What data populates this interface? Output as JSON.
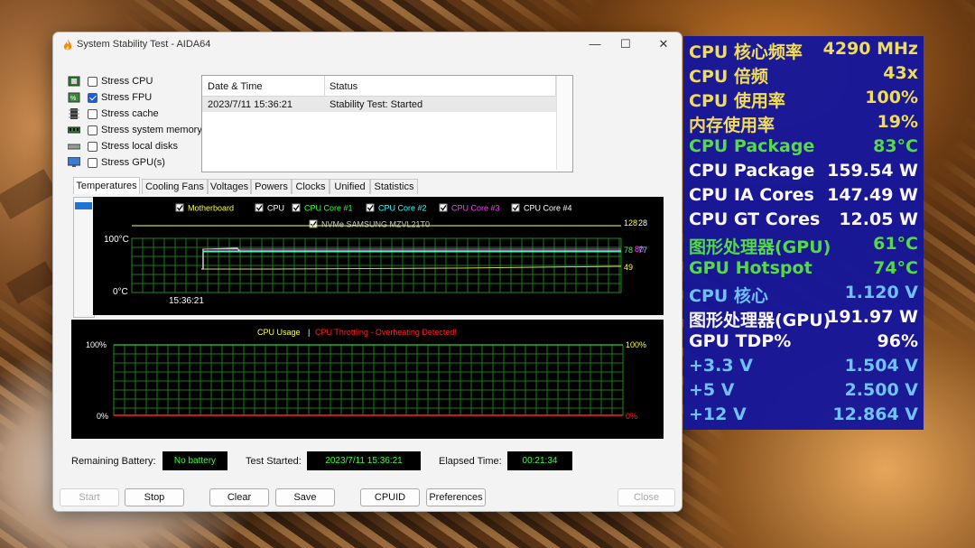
{
  "window": {
    "title": "System Stability Test - AIDA64",
    "minimize": "—",
    "maximize": "☐",
    "close": "✕"
  },
  "stress_options": [
    {
      "label": "Stress CPU",
      "checked": false,
      "icon": "cpu-chip-icon"
    },
    {
      "label": "Stress FPU",
      "checked": true,
      "icon": "fpu-chip-icon"
    },
    {
      "label": "Stress cache",
      "checked": false,
      "icon": "cache-chip-icon"
    },
    {
      "label": "Stress system memory",
      "checked": false,
      "icon": "memory-module-icon"
    },
    {
      "label": "Stress local disks",
      "checked": false,
      "icon": "disk-drive-icon"
    },
    {
      "label": "Stress GPU(s)",
      "checked": false,
      "icon": "monitor-icon"
    }
  ],
  "log": {
    "headers": [
      "Date & Time",
      "Status"
    ],
    "rows": [
      {
        "datetime": "2023/7/11 15:36:21",
        "status": "Stability Test: Started"
      }
    ]
  },
  "tabs": [
    "Temperatures",
    "Cooling Fans",
    "Voltages",
    "Powers",
    "Clocks",
    "Unified",
    "Statistics"
  ],
  "active_tab": "Temperatures",
  "temp_graph": {
    "legend": [
      {
        "label": "Motherboard",
        "color": "#ffff40"
      },
      {
        "label": "CPU",
        "color": "#ffffff"
      },
      {
        "label": "CPU Core #1",
        "color": "#40ff40"
      },
      {
        "label": "CPU Core #2",
        "color": "#40ffff"
      },
      {
        "label": "CPU Core #3",
        "color": "#ff40ff"
      },
      {
        "label": "CPU Core #4",
        "color": "#ffffff"
      }
    ],
    "legend2": {
      "label": "NVMe SAMSUNG MZVL21T0",
      "color": "#c8c8c8"
    },
    "y_top": "100°C",
    "y_bottom": "0°C",
    "x_label": "15:36:21",
    "right_values": [
      {
        "text": "128",
        "color": "#ffff40"
      },
      {
        "text": "28",
        "color": "#ffffff"
      },
      {
        "text": "78",
        "color": "#40ff40"
      },
      {
        "text": "80",
        "color": "#ff40ff"
      },
      {
        "text": "77",
        "color": "#40ffff"
      },
      {
        "text": "49",
        "color": "#ffff40"
      }
    ]
  },
  "usage_graph": {
    "title_left": "CPU Usage",
    "title_sep": "|",
    "title_right": "CPU Throttling - Overheating Detected!",
    "y_top_left": "100%",
    "y_bottom_left": "0%",
    "y_top_right": "100%",
    "y_bottom_right": "0%"
  },
  "status": {
    "battery_label": "Remaining Battery:",
    "battery_value": "No battery",
    "started_label": "Test Started:",
    "started_value": "2023/7/11 15:36:21",
    "elapsed_label": "Elapsed Time:",
    "elapsed_value": "00:21:34"
  },
  "buttons": {
    "start": "Start",
    "stop": "Stop",
    "clear": "Clear",
    "save": "Save",
    "cpuid": "CPUID",
    "preferences": "Preferences",
    "close": "Close"
  },
  "osd": [
    {
      "label": "CPU 核心频率",
      "value": "4290 MHz",
      "color": "#f3e25a"
    },
    {
      "label": "CPU 倍频",
      "value": "43x",
      "color": "#f3e25a"
    },
    {
      "label": "CPU 使用率",
      "value": "100%",
      "color": "#f3e25a"
    },
    {
      "label": "内存使用率",
      "value": "19%",
      "color": "#f3e25a"
    },
    {
      "label": "CPU Package",
      "value": "83°C",
      "color": "#54e04a"
    },
    {
      "label": "CPU Package",
      "value": "159.54 W",
      "color": "#ffffff"
    },
    {
      "label": "CPU IA Cores",
      "value": "147.49 W",
      "color": "#ffffff"
    },
    {
      "label": "CPU GT Cores",
      "value": "12.05 W",
      "color": "#ffffff"
    },
    {
      "label": "图形处理器(GPU)",
      "value": "61°C",
      "color": "#54e04a"
    },
    {
      "label": "GPU Hotspot",
      "value": "74°C",
      "color": "#54e04a"
    },
    {
      "label": "CPU 核心",
      "value": "1.120 V",
      "color": "#6ec6ff"
    },
    {
      "label": "图形处理器(GPU)",
      "value": "191.97 W",
      "color": "#ffffff"
    },
    {
      "label": "GPU TDP%",
      "value": "96%",
      "color": "#ffffff"
    },
    {
      "label": "+3.3 V",
      "value": "1.504 V",
      "color": "#6ec6ff"
    },
    {
      "label": "+5 V",
      "value": "2.500 V",
      "color": "#6ec6ff"
    },
    {
      "label": "+12 V",
      "value": "12.864 V",
      "color": "#6ec6ff"
    }
  ]
}
